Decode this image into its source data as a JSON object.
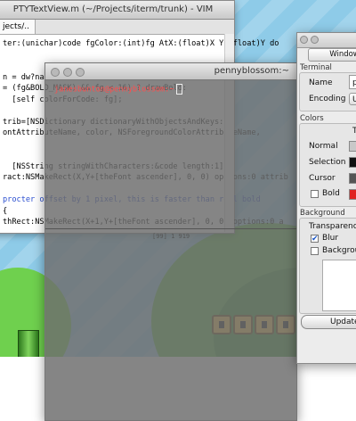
{
  "vim": {
    "title": "PTYTextView.m (~/Projects/iterm/trunk) - VIM",
    "tab": "jects/..",
    "lines": [
      "ter:(unichar)code fgColor:(int)fg AtX:(float)X Y:(float)Y do",
      "",
      "",
      "n = dw?nafont",
      "= (fg&BOLD_MASK) && fg < 16) ? drawBold:",
      "  [self colorForCode: fg];",
      "",
      "trib=[NSDictionary dictionaryWithObjectsAndKeys:",
      "ontAttributeName, color, NSForegroundColorAttributeName,",
      "",
      "",
      "  [NSString stringWithCharacters:&code length:1];",
      "ract:NSMakeRect(X,Y+[theFont ascender], 0, 0) options:0 attrib",
      "",
      "procter offset by 1 pixel, this is faster than real bold",
      "{",
      "thRect:NSMakeRect(X+1,Y+[theFont ascender], 0, 0) options:0 a"
    ]
  },
  "terminal": {
    "title": "pennyblossom:~",
    "prompt": "janesbunton@pennyblossom:~",
    "status": "[99] 1          919"
  },
  "prefs": {
    "window_button": "Window",
    "terminal_section": "Terminal",
    "name_label": "Name",
    "name_value": "pe",
    "encoding_label": "Encoding",
    "encoding_value": "U",
    "colors_section": "Colors",
    "colors_col": "Te",
    "normal_label": "Normal",
    "selection_label": "Selection",
    "cursor_label": "Cursor",
    "bold_label": "Bold",
    "background_section": "Background",
    "transparency_label": "Transparency",
    "blur_label": "Blur",
    "blur_checked": "✔",
    "background_image_label": "Backgroun",
    "update_button": "Update",
    "normal_color": "#c8c8c8",
    "selection_color": "#111111",
    "cursor_color": "#555555",
    "bold_color": "#e02020"
  }
}
